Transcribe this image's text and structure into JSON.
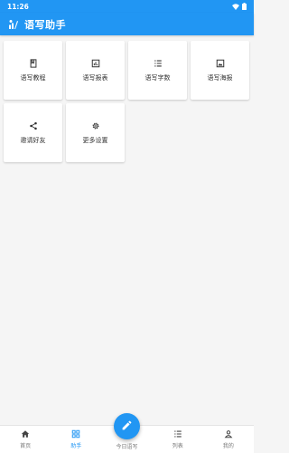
{
  "status_bar": {
    "time": "11:26"
  },
  "app_bar": {
    "title": "语写助手",
    "logo_icon": "app-logo-icon"
  },
  "grid_items": [
    {
      "label": "语写教程",
      "icon": "book-icon"
    },
    {
      "label": "语写报表",
      "icon": "chart-icon"
    },
    {
      "label": "语写字数",
      "icon": "list-icon"
    },
    {
      "label": "语写海报",
      "icon": "image-icon"
    },
    {
      "label": "邀请好友",
      "icon": "share-icon"
    },
    {
      "label": "更多设置",
      "icon": "gear-icon"
    }
  ],
  "bottom_nav": [
    {
      "label": "首页",
      "icon": "home-icon",
      "active": false
    },
    {
      "label": "助手",
      "icon": "grid-icon",
      "active": true
    },
    {
      "label": "今日语写",
      "icon": "pencil-icon",
      "active": false
    },
    {
      "label": "列表",
      "icon": "list-icon",
      "active": false
    },
    {
      "label": "我的",
      "icon": "person-icon",
      "active": false
    }
  ],
  "colors": {
    "primary": "#2196f3",
    "background": "#f5f5f5",
    "inactive": "#777777"
  }
}
